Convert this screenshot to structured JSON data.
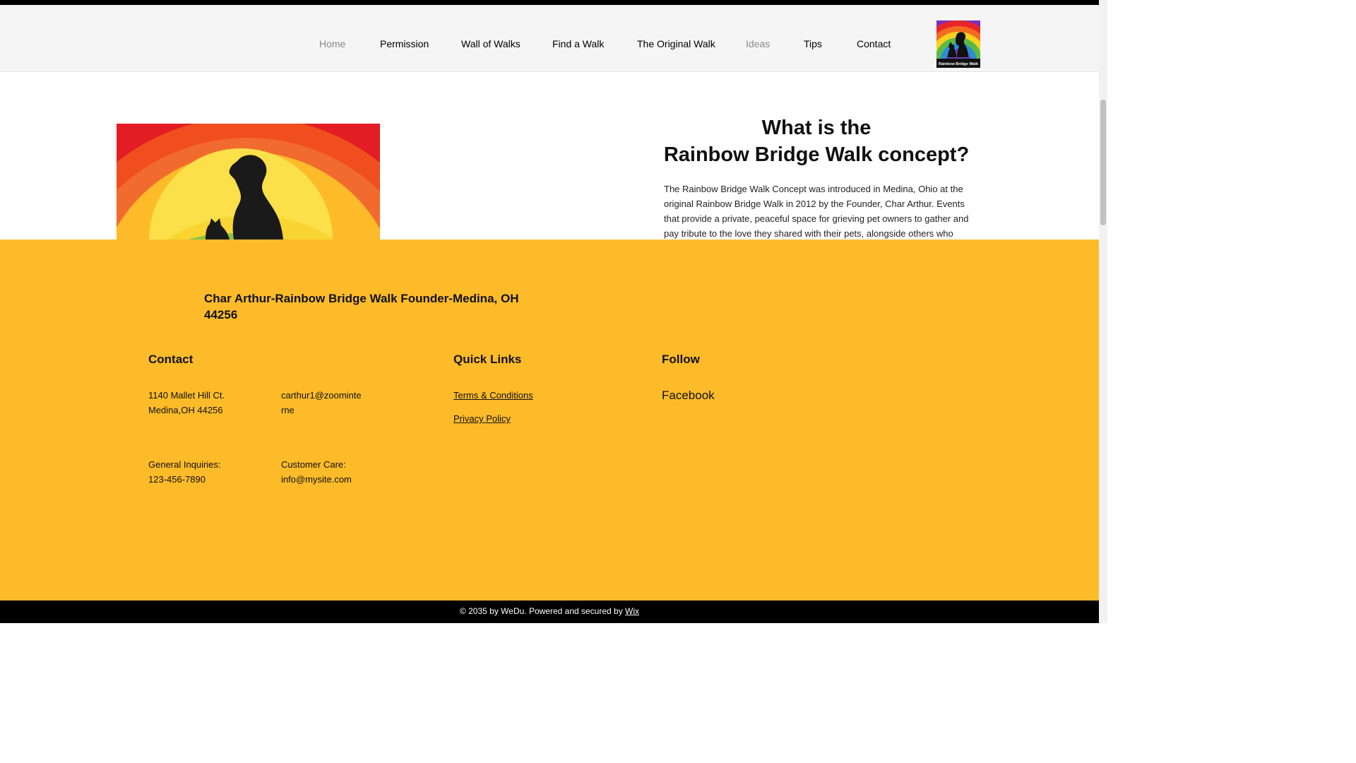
{
  "header": {
    "nav": [
      {
        "label": "Home",
        "muted": true
      },
      {
        "label": "Permission",
        "muted": false
      },
      {
        "label": "Wall of Walks",
        "muted": false
      },
      {
        "label": "Find a Walk",
        "muted": false
      },
      {
        "label": "The Original Walk",
        "muted": false
      },
      {
        "label": "Ideas",
        "muted": true
      },
      {
        "label": "Tips",
        "muted": false
      },
      {
        "label": "Contact",
        "muted": false
      }
    ],
    "logo_text": "Rainbow Bridge Walk"
  },
  "hero": {
    "title_line1": "What is the",
    "title_line2": "Rainbow Bridge Walk concept?",
    "text": "The Rainbow Bridge Walk Concept was introduced in Medina, Ohio at the original Rainbow Bridge Walk in 2012 by the Founder, Char Arthur. Events that provide a private, peaceful space for grieving pet owners to gather and pay tribute to the love they shared with their pets, alongside others who"
  },
  "footer": {
    "founder": "Char Arthur-Rainbow Bridge Walk Founder-Medina, OH 44256",
    "contact": {
      "heading": "Contact",
      "address_line1": "1140 Mallet Hill Ct.",
      "address_line2": "Medina,OH 44256",
      "email_line1": "carthur1@zoominte",
      "email_line2": "rne",
      "general_label": "General Inquiries:",
      "general_phone": "123-456-7890",
      "care_label": "Customer Care:",
      "care_email": "info@mysite.com"
    },
    "quick_links": {
      "heading": "Quick Links",
      "terms": "Terms & Conditions",
      "privacy": "Privacy Policy"
    },
    "follow": {
      "heading": "Follow",
      "facebook": "Facebook"
    },
    "copyright_prefix": "© 2035 by WeDu. Powered and secured by ",
    "copyright_link": "Wix"
  },
  "colors": {
    "footer_bg": "#fdbb2a",
    "header_bg": "#f5f5f5",
    "muted_nav": "#8a8a8a"
  }
}
